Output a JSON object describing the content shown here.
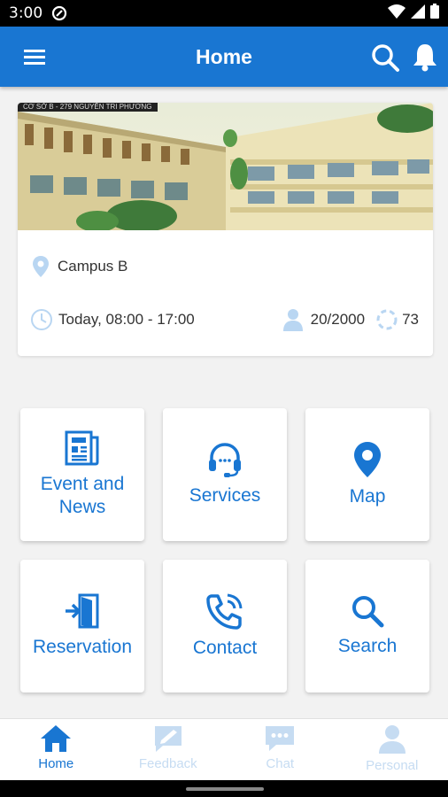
{
  "status_bar": {
    "time": "3:00"
  },
  "app_bar": {
    "title": "Home"
  },
  "event": {
    "location": "Campus B",
    "time": "Today, 08:00 - 17:00",
    "attendance": "20/2000",
    "count": "73",
    "photo_caption": "CƠ SỞ B - 279 NGUYỄN TRI PHƯƠNG"
  },
  "tiles": [
    {
      "label_line1": "Event and",
      "label_line2": "News",
      "icon": "newspaper-icon"
    },
    {
      "label": "Services",
      "icon": "headset-icon"
    },
    {
      "label": "Map",
      "icon": "map-pin-icon"
    },
    {
      "label": "Reservation",
      "icon": "login-door-icon"
    },
    {
      "label": "Contact",
      "icon": "phone-ringing-icon"
    },
    {
      "label": "Search",
      "icon": "search-icon"
    }
  ],
  "bottom_nav": [
    {
      "label": "Home",
      "icon": "home-icon",
      "active": true
    },
    {
      "label": "Feedback",
      "icon": "feedback-icon",
      "active": false
    },
    {
      "label": "Chat",
      "icon": "chat-icon",
      "active": false
    },
    {
      "label": "Personal",
      "icon": "person-icon",
      "active": false
    }
  ],
  "colors": {
    "primary": "#1976d2",
    "inactive_nav": "#c6dcf2",
    "background": "#f2f2f2"
  }
}
